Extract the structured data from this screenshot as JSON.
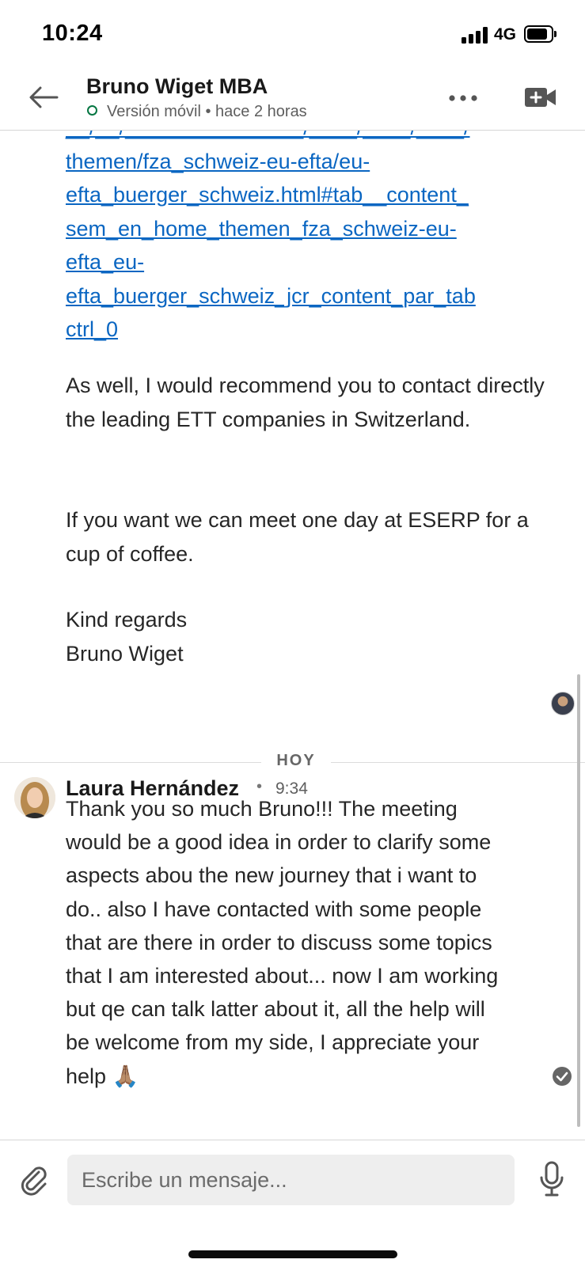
{
  "status_bar": {
    "time": "10:24",
    "network": "4G"
  },
  "header": {
    "contact_name": "Bruno Wiget MBA",
    "presence": "Versión móvil • hace 2 horas"
  },
  "thread": {
    "link_lines": [
      "themen/fza_schweiz-eu-efta/eu-",
      "efta_buerger_schweiz.html#tab__content_",
      "sem_en_home_themen_fza_schweiz-eu-",
      "efta_eu-",
      "efta_buerger_schweiz_jcr_content_par_tab",
      "ctrl_0"
    ],
    "paragraphs": [
      "As well, I would recommend you to contact directly  the leading ETT companies in Switzerland.",
      "If you want we can meet one day at ESERP for a cup of coffee.",
      "Kind regards\nBruno Wiget"
    ],
    "day_divider": "HOY",
    "message": {
      "sender": "Laura Hernández",
      "separator": "•",
      "time": "9:34",
      "lines": [
        "Thank you so much Bruno!!! The meeting",
        "would be a good idea in order to clarify some",
        "aspects abou the new journey that i want to",
        "do.. also I have contacted with some people",
        "that are there in order to discuss some topics",
        "that I am interested about... now I am working",
        "but qe can talk latter about it, all the help will",
        "be welcome from my side, I appreciate your",
        "help 🙏🏽"
      ]
    }
  },
  "composer": {
    "placeholder": "Escribe un mensaje..."
  },
  "colors": {
    "link": "#0a66c2",
    "presence": "#057642",
    "text": "#262626"
  },
  "icons": [
    "back-arrow-icon",
    "more-icon",
    "video-call-icon",
    "paperclip-icon",
    "microphone-icon",
    "read-receipt-icon",
    "signal-icon",
    "battery-icon"
  ]
}
